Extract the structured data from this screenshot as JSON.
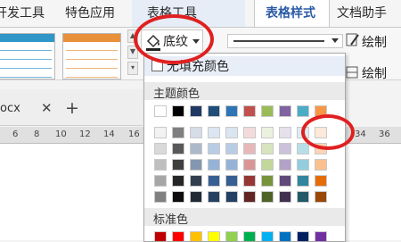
{
  "tabs": [
    "开发工具",
    "特色应用",
    "表格工具",
    "表格样式",
    "文档助手"
  ],
  "active_tab": "表格样式",
  "shading": {
    "label": "底纹"
  },
  "draw_labels": [
    "绘制",
    "绘制"
  ],
  "doc_tab": {
    "label": "ocx",
    "close": "✕",
    "add": "+"
  },
  "ruler_numbers": [
    "6",
    "8",
    "10",
    "12",
    "14",
    "16",
    "34",
    "36"
  ],
  "dropdown": {
    "no_fill": "无填充颜色",
    "theme_title": "主题颜色",
    "standard_title": "标准色"
  },
  "theme_colors": {
    "top_row": [
      "#ffffff",
      "#000000",
      "#203864",
      "#1f4e79",
      "#2e75b6",
      "#c0504d",
      "#9bbb59",
      "#8064a2",
      "#4bacc6",
      "#f79646"
    ],
    "shade_rows": [
      [
        "#f2f2f2",
        "#7f7f7f",
        "#d6dce5",
        "#dce6f2",
        "#dbe5f1",
        "#f2dcdb",
        "#ebf1de",
        "#e5e0ec",
        "#dbeef4",
        "#fde9d9"
      ],
      [
        "#d9d9d9",
        "#595959",
        "#adb9ca",
        "#b8cce4",
        "#b8cce4",
        "#e6b9b8",
        "#d7e4bd",
        "#ccc1da",
        "#b7dee8",
        "#fcd5b5"
      ],
      [
        "#bfbfbf",
        "#3f3f3f",
        "#8497b0",
        "#95b3d7",
        "#95b3d7",
        "#d99694",
        "#c3d69b",
        "#b3a2c7",
        "#93cddd",
        "#fac08f"
      ],
      [
        "#a6a6a6",
        "#262626",
        "#333f50",
        "#366092",
        "#366092",
        "#953735",
        "#77933c",
        "#604a7b",
        "#31859c",
        "#e46c0a"
      ],
      [
        "#808080",
        "#0d0d0d",
        "#222a35",
        "#254061",
        "#244062",
        "#632523",
        "#4f6228",
        "#403151",
        "#215968",
        "#984807"
      ]
    ]
  },
  "standard_colors": [
    "#c00000",
    "#ff0000",
    "#ffc000",
    "#ffff00",
    "#92d050",
    "#00b050",
    "#00b0f0",
    "#0070c0",
    "#002060",
    "#7030a0"
  ],
  "colors": {
    "accent": "#2a5aa5",
    "annotation": "#e02020"
  },
  "icons": [
    "shading-bucket-icon",
    "dropdown-arrow-icon",
    "add-tab-icon",
    "close-tab-icon",
    "gallery-more-icon"
  ]
}
